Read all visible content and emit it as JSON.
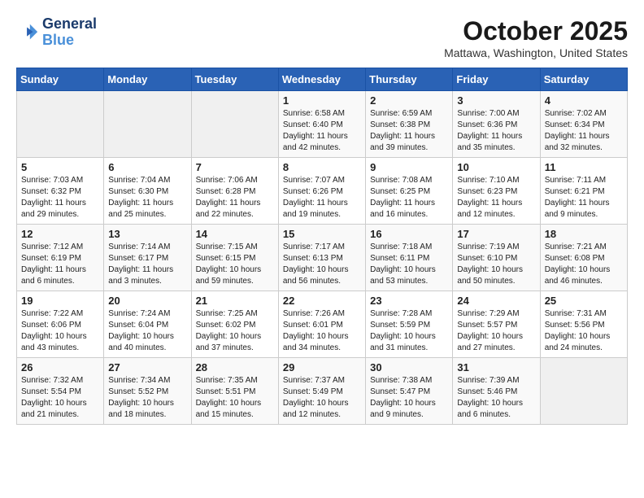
{
  "logo": {
    "line1": "General",
    "line2": "Blue"
  },
  "title": "October 2025",
  "location": "Mattawa, Washington, United States",
  "weekdays": [
    "Sunday",
    "Monday",
    "Tuesday",
    "Wednesday",
    "Thursday",
    "Friday",
    "Saturday"
  ],
  "weeks": [
    [
      {
        "num": "",
        "info": ""
      },
      {
        "num": "",
        "info": ""
      },
      {
        "num": "",
        "info": ""
      },
      {
        "num": "1",
        "info": "Sunrise: 6:58 AM\nSunset: 6:40 PM\nDaylight: 11 hours\nand 42 minutes."
      },
      {
        "num": "2",
        "info": "Sunrise: 6:59 AM\nSunset: 6:38 PM\nDaylight: 11 hours\nand 39 minutes."
      },
      {
        "num": "3",
        "info": "Sunrise: 7:00 AM\nSunset: 6:36 PM\nDaylight: 11 hours\nand 35 minutes."
      },
      {
        "num": "4",
        "info": "Sunrise: 7:02 AM\nSunset: 6:34 PM\nDaylight: 11 hours\nand 32 minutes."
      }
    ],
    [
      {
        "num": "5",
        "info": "Sunrise: 7:03 AM\nSunset: 6:32 PM\nDaylight: 11 hours\nand 29 minutes."
      },
      {
        "num": "6",
        "info": "Sunrise: 7:04 AM\nSunset: 6:30 PM\nDaylight: 11 hours\nand 25 minutes."
      },
      {
        "num": "7",
        "info": "Sunrise: 7:06 AM\nSunset: 6:28 PM\nDaylight: 11 hours\nand 22 minutes."
      },
      {
        "num": "8",
        "info": "Sunrise: 7:07 AM\nSunset: 6:26 PM\nDaylight: 11 hours\nand 19 minutes."
      },
      {
        "num": "9",
        "info": "Sunrise: 7:08 AM\nSunset: 6:25 PM\nDaylight: 11 hours\nand 16 minutes."
      },
      {
        "num": "10",
        "info": "Sunrise: 7:10 AM\nSunset: 6:23 PM\nDaylight: 11 hours\nand 12 minutes."
      },
      {
        "num": "11",
        "info": "Sunrise: 7:11 AM\nSunset: 6:21 PM\nDaylight: 11 hours\nand 9 minutes."
      }
    ],
    [
      {
        "num": "12",
        "info": "Sunrise: 7:12 AM\nSunset: 6:19 PM\nDaylight: 11 hours\nand 6 minutes."
      },
      {
        "num": "13",
        "info": "Sunrise: 7:14 AM\nSunset: 6:17 PM\nDaylight: 11 hours\nand 3 minutes."
      },
      {
        "num": "14",
        "info": "Sunrise: 7:15 AM\nSunset: 6:15 PM\nDaylight: 10 hours\nand 59 minutes."
      },
      {
        "num": "15",
        "info": "Sunrise: 7:17 AM\nSunset: 6:13 PM\nDaylight: 10 hours\nand 56 minutes."
      },
      {
        "num": "16",
        "info": "Sunrise: 7:18 AM\nSunset: 6:11 PM\nDaylight: 10 hours\nand 53 minutes."
      },
      {
        "num": "17",
        "info": "Sunrise: 7:19 AM\nSunset: 6:10 PM\nDaylight: 10 hours\nand 50 minutes."
      },
      {
        "num": "18",
        "info": "Sunrise: 7:21 AM\nSunset: 6:08 PM\nDaylight: 10 hours\nand 46 minutes."
      }
    ],
    [
      {
        "num": "19",
        "info": "Sunrise: 7:22 AM\nSunset: 6:06 PM\nDaylight: 10 hours\nand 43 minutes."
      },
      {
        "num": "20",
        "info": "Sunrise: 7:24 AM\nSunset: 6:04 PM\nDaylight: 10 hours\nand 40 minutes."
      },
      {
        "num": "21",
        "info": "Sunrise: 7:25 AM\nSunset: 6:02 PM\nDaylight: 10 hours\nand 37 minutes."
      },
      {
        "num": "22",
        "info": "Sunrise: 7:26 AM\nSunset: 6:01 PM\nDaylight: 10 hours\nand 34 minutes."
      },
      {
        "num": "23",
        "info": "Sunrise: 7:28 AM\nSunset: 5:59 PM\nDaylight: 10 hours\nand 31 minutes."
      },
      {
        "num": "24",
        "info": "Sunrise: 7:29 AM\nSunset: 5:57 PM\nDaylight: 10 hours\nand 27 minutes."
      },
      {
        "num": "25",
        "info": "Sunrise: 7:31 AM\nSunset: 5:56 PM\nDaylight: 10 hours\nand 24 minutes."
      }
    ],
    [
      {
        "num": "26",
        "info": "Sunrise: 7:32 AM\nSunset: 5:54 PM\nDaylight: 10 hours\nand 21 minutes."
      },
      {
        "num": "27",
        "info": "Sunrise: 7:34 AM\nSunset: 5:52 PM\nDaylight: 10 hours\nand 18 minutes."
      },
      {
        "num": "28",
        "info": "Sunrise: 7:35 AM\nSunset: 5:51 PM\nDaylight: 10 hours\nand 15 minutes."
      },
      {
        "num": "29",
        "info": "Sunrise: 7:37 AM\nSunset: 5:49 PM\nDaylight: 10 hours\nand 12 minutes."
      },
      {
        "num": "30",
        "info": "Sunrise: 7:38 AM\nSunset: 5:47 PM\nDaylight: 10 hours\nand 9 minutes."
      },
      {
        "num": "31",
        "info": "Sunrise: 7:39 AM\nSunset: 5:46 PM\nDaylight: 10 hours\nand 6 minutes."
      },
      {
        "num": "",
        "info": ""
      }
    ]
  ]
}
